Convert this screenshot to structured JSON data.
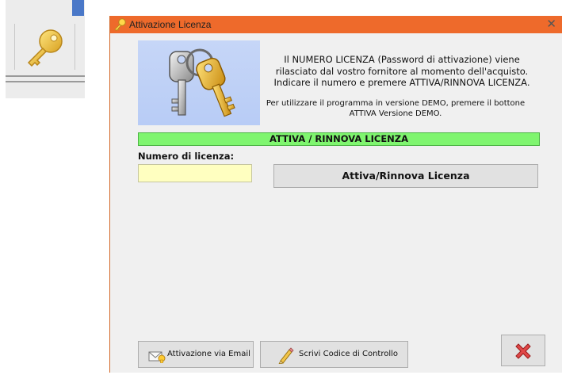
{
  "window": {
    "title": "Attivazione Licenza",
    "close_glyph": "✕",
    "accent_color": "#ee6a2b"
  },
  "info": {
    "main_text": "Il NUMERO LICENZA (Password di attivazione) viene rilasciato dal vostro fornitore al momento dell'acquisto.  Indicare il numero e premere ATTIVA/RINNOVA LICENZA.",
    "demo_text": "Per utilizzare il programma in versione DEMO, premere il bottone ATTIVA Versione DEMO."
  },
  "banner": {
    "text": "ATTIVA / RINNOVA  LICENZA",
    "color": "#7ff56f"
  },
  "license": {
    "label": "Numero di licenza:",
    "value": "",
    "field_color": "#ffffc0"
  },
  "buttons": {
    "activate_label": "Attiva/Rinnova Licenza",
    "email_label": "Attivazione via Email",
    "control_code_label": "Scrivi Codice di Controllo",
    "close_icon": "red-x-icon"
  },
  "icons": {
    "toolbar_key": "key-icon",
    "title_key": "key-icon",
    "illustration": "keys-illustration",
    "email": "envelope-icon",
    "pencil": "pencil-icon"
  }
}
